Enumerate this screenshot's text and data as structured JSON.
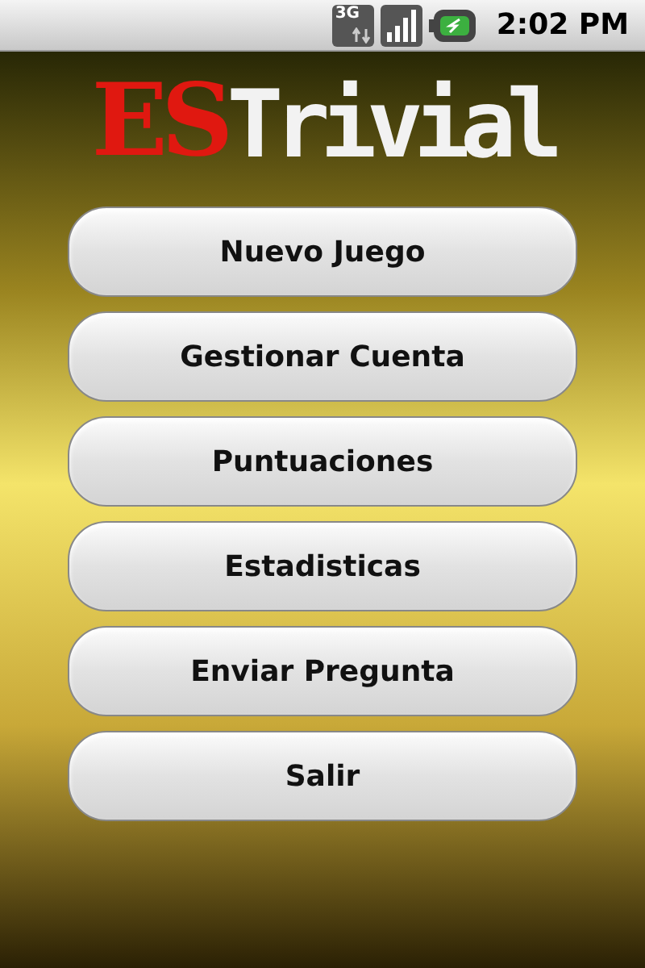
{
  "status_bar": {
    "time": "2:02 PM",
    "network": "3G"
  },
  "logo": {
    "accent": "ES",
    "rest": "Trivial"
  },
  "menu": [
    {
      "label": "Nuevo Juego"
    },
    {
      "label": "Gestionar Cuenta"
    },
    {
      "label": "Puntuaciones"
    },
    {
      "label": "Estadisticas"
    },
    {
      "label": "Enviar Pregunta"
    },
    {
      "label": "Salir"
    }
  ]
}
